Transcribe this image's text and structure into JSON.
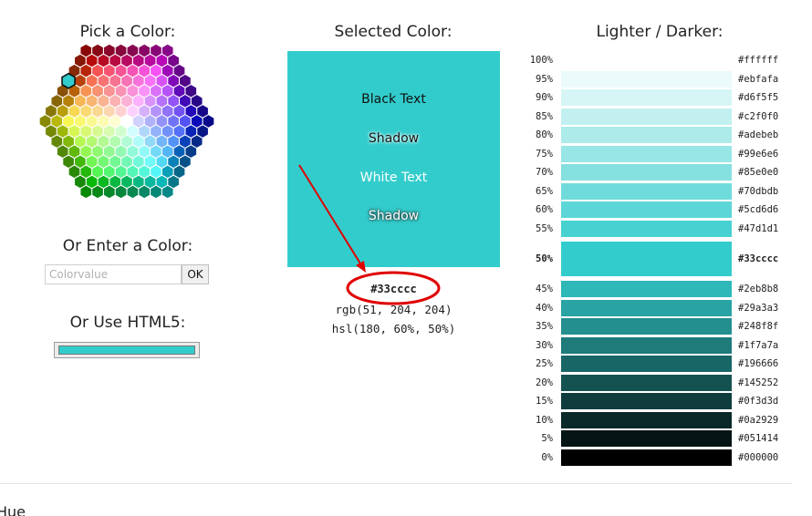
{
  "pick": {
    "title": "Pick a Color:"
  },
  "enter": {
    "title": "Or Enter a Color:",
    "placeholder": "Colorvalue",
    "ok_label": "OK"
  },
  "html5": {
    "title": "Or Use HTML5:",
    "value": "#33cccc"
  },
  "selected": {
    "title": "Selected Color:",
    "color": "#33cccc",
    "black_text": "Black Text",
    "black_shadow": "Shadow",
    "white_text": "White Text",
    "white_shadow": "Shadow",
    "hex": "#33cccc",
    "rgb": "rgb(51, 204, 204)",
    "hsl": "hsl(180, 60%, 50%)"
  },
  "annotation": {
    "color": "#e00000"
  },
  "shades": {
    "title": "Lighter / Darker:",
    "rows": [
      {
        "pct": "100%",
        "hex": "#ffffff"
      },
      {
        "pct": "95%",
        "hex": "#ebfafa"
      },
      {
        "pct": "90%",
        "hex": "#d6f5f5"
      },
      {
        "pct": "85%",
        "hex": "#c2f0f0"
      },
      {
        "pct": "80%",
        "hex": "#adebeb"
      },
      {
        "pct": "75%",
        "hex": "#99e6e6"
      },
      {
        "pct": "70%",
        "hex": "#85e0e0"
      },
      {
        "pct": "65%",
        "hex": "#70dbdb"
      },
      {
        "pct": "60%",
        "hex": "#5cd6d6"
      },
      {
        "pct": "55%",
        "hex": "#47d1d1"
      },
      {
        "pct": "50%",
        "hex": "#33cccc"
      },
      {
        "pct": "45%",
        "hex": "#2eb8b8"
      },
      {
        "pct": "40%",
        "hex": "#29a3a3"
      },
      {
        "pct": "35%",
        "hex": "#248f8f"
      },
      {
        "pct": "30%",
        "hex": "#1f7a7a"
      },
      {
        "pct": "25%",
        "hex": "#196666"
      },
      {
        "pct": "20%",
        "hex": "#145252"
      },
      {
        "pct": "15%",
        "hex": "#0f3d3d"
      },
      {
        "pct": "10%",
        "hex": "#0a2929"
      },
      {
        "pct": "5%",
        "hex": "#051414"
      },
      {
        "pct": "0%",
        "hex": "#000000"
      }
    ]
  },
  "bottom": {
    "text": "Hue"
  }
}
